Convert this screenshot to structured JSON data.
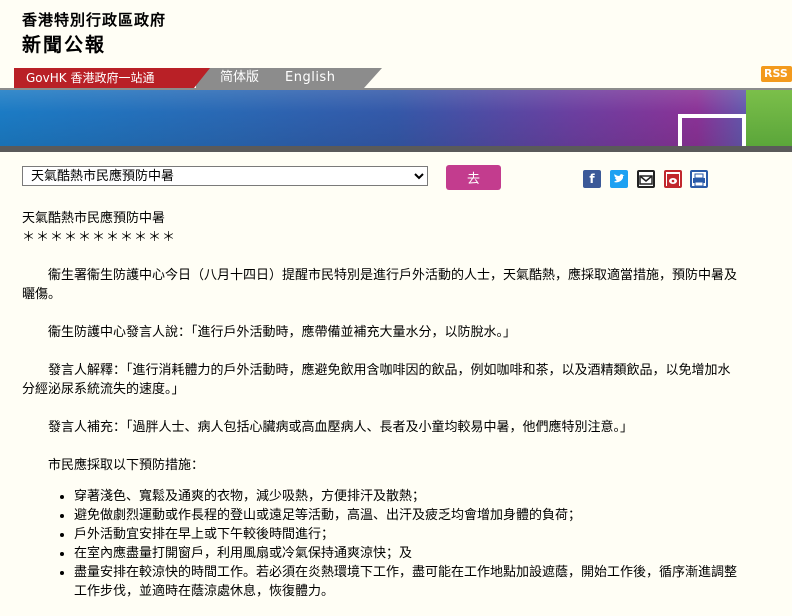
{
  "header": {
    "site_title": "香港特別行政區政府",
    "site_subtitle": "新聞公報"
  },
  "nav": {
    "govhk": "GovHK 香港政府一站通",
    "simplified": "简体版",
    "english": "English",
    "rss": "RSS"
  },
  "toolbar": {
    "select_value": "天氣酷熱市民應預防中暑",
    "go_label": "去"
  },
  "share_icons": [
    "facebook-icon",
    "twitter-icon",
    "email-icon",
    "weibo-icon",
    "print-icon"
  ],
  "colors": {
    "govhk_red": "#b92026",
    "go_button": "#c33c8e",
    "rss_orange": "#f39a1d"
  },
  "article": {
    "title": "天氣酷熱市民應預防中暑",
    "stars": "＊＊＊＊＊＊＊＊＊＊＊",
    "paragraphs": [
      "衞生署衞生防護中心今日（八月十四日）提醒市民特別是進行戶外活動的人士，天氣酷熱，應採取適當措施，預防中暑及曬傷。",
      "衞生防護中心發言人說：「進行戶外活動時，應帶備並補充大量水分，以防脫水。」",
      "發言人解釋：「進行消耗體力的戶外活動時，應避免飲用含咖啡因的飲品，例如咖啡和茶，以及酒精類飲品，以免增加水分經泌尿系統流失的速度。」",
      "發言人補充：「過胖人士、病人包括心臟病或高血壓病人、長者及小童均較易中暑，他們應特別注意。」",
      "市民應採取以下預防措施："
    ],
    "measures": [
      "穿著淺色、寬鬆及通爽的衣物，減少吸熱，方便排汗及散熱；",
      "避免做劇烈運動或作長程的登山或遠足等活動，高溫、出汗及疲乏均會增加身體的負荷；",
      "戶外活動宜安排在早上或下午較後時間進行；",
      "在室內應盡量打開窗戶，利用風扇或冷氣保持通爽涼快；及",
      "盡量安排在較涼快的時間工作。若必須在炎熱環境下工作，盡可能在工作地點加設遮蔭，開始工作後，循序漸進調整工作步伐，並適時在蔭涼處休息，恢復體力。"
    ]
  }
}
